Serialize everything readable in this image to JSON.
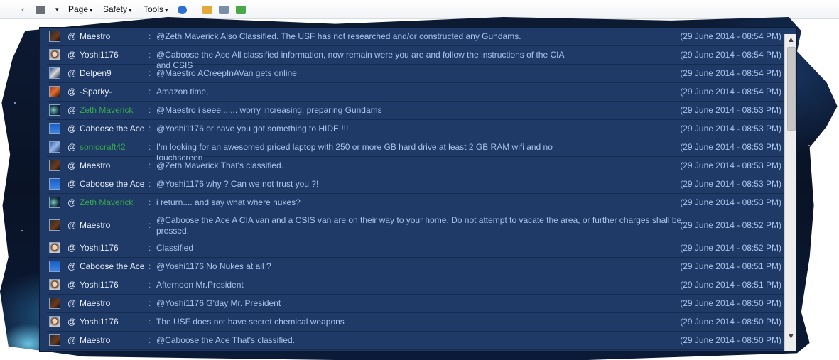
{
  "toolbar": {
    "page_label": "Page",
    "safety_label": "Safety",
    "tools_label": "Tools",
    "caret": "▾"
  },
  "chat": {
    "at_symbol": "@",
    "separator": ":",
    "messages": [
      {
        "user": "Maestro",
        "text": "@Zeth Maverick Also Classified. The USF has not researched and/or constructed any Gundams.",
        "time": "(29 June 2014 - 08:54 PM)",
        "avatar": "dark"
      },
      {
        "user": "Yoshi1176",
        "text": "@Caboose the Ace All classified information, now remain were you are and follow the instructions of the CIA and CSIS",
        "time": "(29 June 2014 - 08:54 PM)",
        "avatar": "face"
      },
      {
        "user": "Delpen9",
        "text": "@Maestro ACreepInAVan gets online",
        "time": "(29 June 2014 - 08:54 PM)",
        "avatar": "mech"
      },
      {
        "user": "-Sparky-",
        "text": "Amazon time,",
        "time": "(29 June 2014 - 08:54 PM)",
        "avatar": "fire"
      },
      {
        "user": "Zeth Maverick",
        "text": "@Maestro i seee....... worry increasing, preparing Gundams",
        "time": "(29 June 2014 - 08:53 PM)",
        "avatar": "space",
        "green": true
      },
      {
        "user": "Caboose the Ace",
        "text": "@Yoshi1176 or have you got something to HIDE !!!",
        "time": "(29 June 2014 - 08:53 PM)",
        "avatar": "blue"
      },
      {
        "user": "soniccraft42",
        "text": "I'm looking for an awesomed priced laptop with 250 or more GB hard drive at least 2 GB RAM wifi and no touchscreen",
        "time": "(29 June 2014 - 08:53 PM)",
        "avatar": "sonic",
        "green": true
      },
      {
        "user": "Maestro",
        "text": "@Zeth Maverick That's classified.",
        "time": "(29 June 2014 - 08:53 PM)",
        "avatar": "dark"
      },
      {
        "user": "Caboose the Ace",
        "text": "@Yoshi1176 why ? Can we not trust you ?!",
        "time": "(29 June 2014 - 08:53 PM)",
        "avatar": "blue"
      },
      {
        "user": "Zeth Maverick",
        "text": "i return.... and say what where nukes?",
        "time": "(29 June 2014 - 08:53 PM)",
        "avatar": "space",
        "green": true
      },
      {
        "user": "Maestro",
        "text": "@Caboose the Ace A CIA van and a CSIS van are on their way to your home. Do not attempt to vacate the area, or further charges shall be pressed.",
        "time": "(29 June 2014 - 08:52 PM)",
        "avatar": "dark",
        "tall": true
      },
      {
        "user": "Yoshi1176",
        "text": "Classified",
        "time": "(29 June 2014 - 08:52 PM)",
        "avatar": "face"
      },
      {
        "user": "Caboose the Ace",
        "text": "@Yoshi1176 No Nukes at all ?",
        "time": "(29 June 2014 - 08:51 PM)",
        "avatar": "blue"
      },
      {
        "user": "Yoshi1176",
        "text": "Afternoon Mr.President",
        "time": "(29 June 2014 - 08:51 PM)",
        "avatar": "face"
      },
      {
        "user": "Maestro",
        "text": "@Yoshi1176 G'day Mr. President",
        "time": "(29 June 2014 - 08:50 PM)",
        "avatar": "dark"
      },
      {
        "user": "Yoshi1176",
        "text": "The USF does not have secret chemical weapons",
        "time": "(29 June 2014 - 08:50 PM)",
        "avatar": "face"
      },
      {
        "user": "Maestro",
        "text": "@Caboose the Ace That's classified.",
        "time": "(29 June 2014 - 08:50 PM)",
        "avatar": "dark"
      }
    ]
  },
  "scrollbar": {
    "up": "▲",
    "down": "▼"
  },
  "colors": {
    "panel": "#1f3a66",
    "username_default": "#e6eefc",
    "username_green": "#38a84a",
    "message": "#a9c5ee"
  }
}
